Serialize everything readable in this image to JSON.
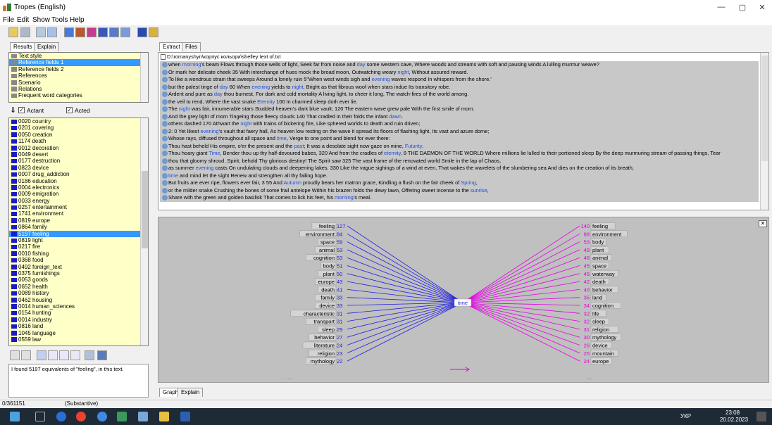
{
  "window": {
    "title": "Tropes (English)",
    "minimize": "—",
    "maximize": "▢",
    "close": "✕"
  },
  "menu": [
    "File",
    "Edit",
    "Show",
    "Tools",
    "Help"
  ],
  "left_tabs": [
    "Results",
    "Explain"
  ],
  "categories": [
    {
      "label": "Text style",
      "selected": false
    },
    {
      "label": "Reference fields 1",
      "selected": true
    },
    {
      "label": "Reference fields 2",
      "selected": false
    },
    {
      "label": "References",
      "selected": false
    },
    {
      "label": "Scenario",
      "selected": false
    },
    {
      "label": "Relations",
      "selected": false
    },
    {
      "label": "Frequent word categories",
      "selected": false
    }
  ],
  "filters": {
    "actant": "Actant",
    "acted": "Acted"
  },
  "references": [
    "0020 country",
    "0201 covering",
    "0050 creation",
    "1174 death",
    "0012 decoration",
    "0049 desert",
    "0177 destruction",
    "0823 device",
    "0007 drug_addiction",
    "0186 education",
    "0004 electronics",
    "0009 emigration",
    "0033 energy",
    "0257 entertainment",
    "1741 environment",
    "0819 europe",
    "0864 family",
    "5197 feeling",
    "0819 light",
    "0217 fire",
    "0010 fishing",
    "0368 food",
    "0492 foreign_text",
    "0375 furnishings",
    "0053 goods",
    "0652 health",
    "0089 history",
    "0462 housing",
    "0014 human_sciences",
    "0154 hunting",
    "0014 industry",
    "0816 land",
    "1045 language",
    "0559 law"
  ],
  "selected_reference": "5197 feeling",
  "info_text": "I found 5197 equivalents of \"feeling\", in this text.",
  "right_tabs": [
    "Extract",
    "Files"
  ],
  "file_path": "D:\\romanyshyn\\корпус кольори\\shelley text of.txt",
  "extract_lines": [
    [
      [
        "when "
      ],
      [
        "morning",
        "h"
      ],
      [
        "'s beam Flows through those wells of light, Seek far from noise and "
      ],
      [
        "day",
        "h"
      ],
      [
        " some western cave, Where woods and streams with soft and pausing winds A lulling murmur weave?"
      ]
    ],
    [
      [
        "Or mark her delicate cheek 35 With interchange of hues mock the broad moon, Outwatching weary "
      ],
      [
        "night",
        "h"
      ],
      [
        ", Without assured reward."
      ]
    ],
    [
      [
        "To like a wondrous strain that sweeps Around a lonely ruin 5\"When west winds sigh and "
      ],
      [
        "evening",
        "h"
      ],
      [
        " waves respond In whispers from the shore.'"
      ]
    ],
    [
      [
        "but the palest tinge of "
      ],
      [
        "day",
        "h"
      ],
      [
        " 60 When "
      ],
      [
        "evening",
        "h"
      ],
      [
        " yields to "
      ],
      [
        "night",
        "h"
      ],
      [
        ", Bright as that fibrous woof when stars indue Its transitory robe."
      ]
    ],
    [
      [
        "Ardent and pure as "
      ],
      [
        "day",
        "h"
      ],
      [
        " thou burnest, For dark and cold mortality A living light, to cheer it long, The watch-fires of the world among."
      ]
    ],
    [
      [
        "the veil to rend, Where the vast snake "
      ],
      [
        "Eternity",
        "h"
      ],
      [
        " 100 In charmed sleep doth ever lie."
      ]
    ],
    [
      [
        "The "
      ],
      [
        "night",
        "h"
      ],
      [
        " was fair, innumerable stars Studded heaven's dark blue vault; 120 The eastern wave grew pale With the first smile of morn."
      ]
    ],
    [
      [
        "And the grey light of morn Tingeing those fleecy clouds 140 That cradled in their folds the infant "
      ],
      [
        "dawn",
        "h"
      ],
      [
        "."
      ]
    ],
    [
      [
        "others dashed 170 Athwart the "
      ],
      [
        "night",
        "h"
      ],
      [
        " with trains of bickering fire,  Like sphered worlds to death and ruin driven;"
      ]
    ],
    [
      [
        "2: 0 Yet likest "
      ],
      [
        "evening",
        "h"
      ],
      [
        "'s vault that faery hall,  As heaven low resting on the wave it spread Its floors of flashing light, Its vast and azure dome;"
      ]
    ],
    [
      [
        "Whose rays, diffused throughout all space and "
      ],
      [
        "time",
        "h"
      ],
      [
        ", Verge to one point and blend for ever there:"
      ]
    ],
    [
      [
        "Thou hast beheld His empire, o'er the present and the "
      ],
      [
        "past",
        "h"
      ],
      [
        "; It was a desolate sight now gaze on mine, "
      ],
      [
        "Futurity",
        "h"
      ],
      [
        "."
      ]
    ],
    [
      [
        "Thou hoary giant "
      ],
      [
        "Time",
        "h"
      ],
      [
        ", Bender thou up thy half-devoured babes, 320 And from the cradles of "
      ],
      [
        "eternity",
        "h"
      ],
      [
        ", 8 THE DAEMON OF THE WORLD Where millions lie lulled to their portioned sleep By the deep murmuring stream of passing things, Tear"
      ]
    ],
    [
      [
        "thou that gloomy shroud. Spirit, behold Thy glorious destiny! The Spirit saw 325 The vast frame of the renovated world Smile in the lap of Chaos,"
      ]
    ],
    [
      [
        "as summer "
      ],
      [
        "evening",
        "h"
      ],
      [
        " casts On undulating clouds and deepening lakes.  330 Like the vague sighings of a wind at even, That wakes the wavelets of the slumbering sea And dies on the creation of its breath,"
      ]
    ],
    [
      [
        "time",
        "h"
      ],
      [
        " and mind let the sight Renew  and strengthen all thy failing hope."
      ]
    ],
    [
      [
        "But fruits are ever ripe, flowers ever fair, 3 55 And "
      ],
      [
        "Autumn",
        "h"
      ],
      [
        " proudly bears her matron grace, Kindling a flush on the fair cheek of "
      ],
      [
        "Spring",
        "h"
      ],
      [
        ","
      ]
    ],
    [
      [
        "or the milder snake Crushing the bones of some frail antelope Within his brazen folds the dewy lawn, Offering sweet incense to the "
      ],
      [
        "sunrise",
        "h"
      ],
      [
        ","
      ]
    ],
    [
      [
        "Share with the green and golden basilisk That comes to lick his feet, his "
      ],
      [
        "morning",
        "h"
      ],
      [
        "'s meal."
      ]
    ]
  ],
  "graph_tabs": [
    "Graph",
    "Explain"
  ],
  "graph_center": "time",
  "graph_left": [
    {
      "label": "feeling",
      "value": 127
    },
    {
      "label": "environment",
      "value": 84
    },
    {
      "label": "space",
      "value": 59
    },
    {
      "label": "animal",
      "value": 53
    },
    {
      "label": "cognition",
      "value": 53
    },
    {
      "label": "body",
      "value": 51
    },
    {
      "label": "plant",
      "value": 50
    },
    {
      "label": "europe",
      "value": 43
    },
    {
      "label": "death",
      "value": 41
    },
    {
      "label": "family",
      "value": 33
    },
    {
      "label": "device",
      "value": 33
    },
    {
      "label": "characteristic",
      "value": 31
    },
    {
      "label": "transport",
      "value": 31
    },
    {
      "label": "sleep",
      "value": 29
    },
    {
      "label": "behavior",
      "value": 27
    },
    {
      "label": "literature",
      "value": 24
    },
    {
      "label": "religion",
      "value": 23
    },
    {
      "label": "mythology",
      "value": 22
    }
  ],
  "graph_right": [
    {
      "label": "feeling",
      "value": 140
    },
    {
      "label": "environment",
      "value": 88
    },
    {
      "label": "body",
      "value": 53
    },
    {
      "label": "plant",
      "value": 49
    },
    {
      "label": "animal",
      "value": 46
    },
    {
      "label": "space",
      "value": 45
    },
    {
      "label": "waterway",
      "value": 45
    },
    {
      "label": "death",
      "value": 42
    },
    {
      "label": "behavior",
      "value": 40
    },
    {
      "label": "land",
      "value": 35
    },
    {
      "label": "cognition",
      "value": 34
    },
    {
      "label": "life",
      "value": 32
    },
    {
      "label": "sleep",
      "value": 32
    },
    {
      "label": "religion",
      "value": 31
    },
    {
      "label": "mythology",
      "value": 30
    },
    {
      "label": "device",
      "value": 26
    },
    {
      "label": "mountain",
      "value": 25
    },
    {
      "label": "europe",
      "value": 24
    }
  ],
  "graph_more": "...",
  "colors": {
    "left_edges": "#1f1fe0",
    "right_edges": "#e000e0",
    "highlight": "#1f4fdd"
  },
  "status": {
    "position": "0/361151",
    "category": "(Substantive)"
  },
  "taskbar": {
    "lang": "УКР",
    "time": "23:08",
    "date": "20.02.2023"
  }
}
